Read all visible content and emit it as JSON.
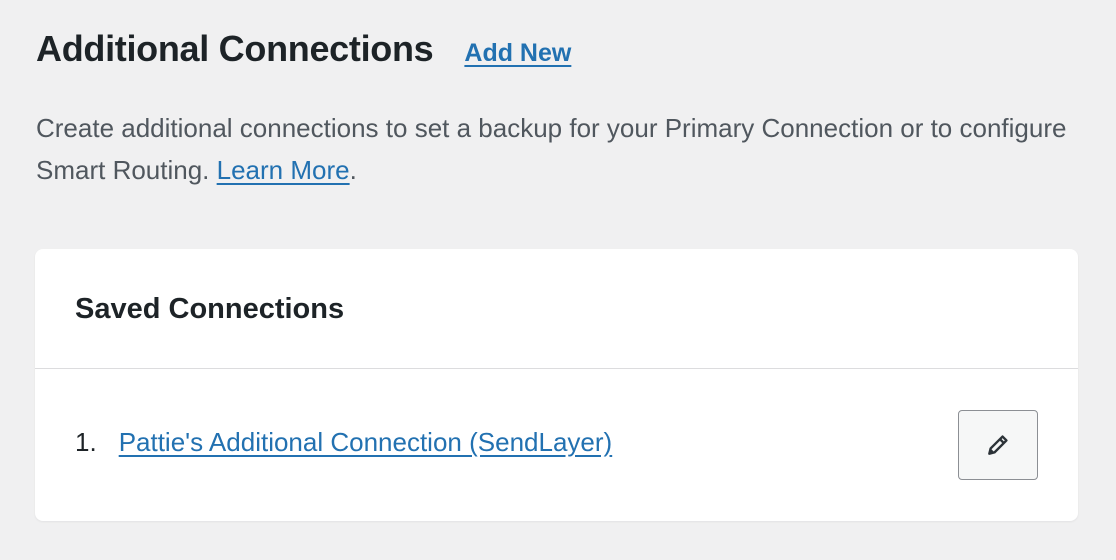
{
  "header": {
    "title": "Additional Connections",
    "add_new_label": "Add New"
  },
  "description": {
    "text": "Create additional connections to set a backup for your Primary Connection or to configure Smart Routing. ",
    "learn_more_label": "Learn More",
    "trailing": "."
  },
  "card": {
    "title": "Saved Connections",
    "connections": [
      {
        "index": "1.",
        "name": "Pattie's Additional Connection (SendLayer)",
        "edit_icon": "pencil-icon"
      }
    ]
  },
  "colors": {
    "background": "#f0f0f1",
    "link": "#2271b1",
    "card": "#ffffff"
  }
}
